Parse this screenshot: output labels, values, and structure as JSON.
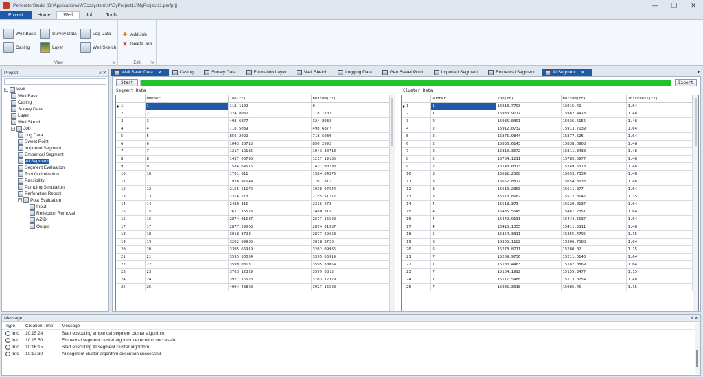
{
  "window": {
    "title": "PerforatorStudio [D:\\Application\\eWEcosystem\\sh\\ByProject11\\MyProject11.perfprj]",
    "minimize": "—",
    "maximize": "❐",
    "close": "✕"
  },
  "menu": {
    "project": "Project",
    "items": [
      "Home",
      "Well",
      "Job",
      "Tools"
    ]
  },
  "ribbon": {
    "view_group": {
      "label": "View",
      "buttons": [
        "Well Basic",
        "Survey Data",
        "Log Data",
        "Casing",
        "Layer",
        "Well Sketch"
      ]
    },
    "edit_group": {
      "label": "Edit",
      "buttons": [
        "Add Job",
        "Delete Job"
      ]
    }
  },
  "project_panel": {
    "title": "Project",
    "pin": "# ✕",
    "tree": [
      {
        "label": "Well",
        "level": 0,
        "expander": "-"
      },
      {
        "label": "Well Basic",
        "level": 1
      },
      {
        "label": "Casing",
        "level": 1
      },
      {
        "label": "Survey Data",
        "level": 1
      },
      {
        "label": "Layer",
        "level": 1
      },
      {
        "label": "Well Sketch",
        "level": 1
      },
      {
        "label": "Job",
        "level": 1,
        "expander": "-"
      },
      {
        "label": "Log Data",
        "level": 2
      },
      {
        "label": "Sweet Point",
        "level": 2
      },
      {
        "label": "Imported Segment",
        "level": 2
      },
      {
        "label": "Emperical Segment",
        "level": 2
      },
      {
        "label": "AI Segment",
        "level": 2,
        "selected": true
      },
      {
        "label": "Segment Evaluation",
        "level": 2
      },
      {
        "label": "Tool Optimization",
        "level": 2
      },
      {
        "label": "Passibility",
        "level": 2
      },
      {
        "label": "Pumping Simulation",
        "level": 2
      },
      {
        "label": "Perforation Report",
        "level": 2
      },
      {
        "label": "Post Evaluation",
        "level": 2,
        "expander": "-"
      },
      {
        "label": "Input",
        "level": 3
      },
      {
        "label": "Reflection Removal",
        "level": 3
      },
      {
        "label": "AZID",
        "level": 3
      },
      {
        "label": "Output",
        "level": 3
      }
    ]
  },
  "tabs": [
    {
      "label": "Well Basic Data",
      "active": true
    },
    {
      "label": "Casing"
    },
    {
      "label": "Survey Data"
    },
    {
      "label": "Formation Layer"
    },
    {
      "label": "Well Sketch"
    },
    {
      "label": "Logging Data"
    },
    {
      "label": "Geo Sweet Point"
    },
    {
      "label": "Imported Segment"
    },
    {
      "label": "Emperical Segment"
    },
    {
      "label": "AI Segment",
      "active": true
    }
  ],
  "toolbar": {
    "start_label": "Start",
    "export_label": "Export",
    "progress_fraction": 1.0
  },
  "segment_grid": {
    "title": "Segment Data",
    "columns": [
      "Number",
      "Top(ft)",
      "Bottom(ft)"
    ],
    "rows": [
      [
        "1",
        "118.1102",
        "0"
      ],
      [
        "2",
        "324.8032",
        "118.1102"
      ],
      [
        "3",
        "498.6877",
        "324.8032"
      ],
      [
        "4",
        "718.5039",
        "498.6877"
      ],
      [
        "5",
        "856.2992",
        "718.5039"
      ],
      [
        "6",
        "1043.30713",
        "856.2992"
      ],
      [
        "7",
        "1217.19185",
        "1043.30713"
      ],
      [
        "8",
        "1437.00793",
        "1217.19185"
      ],
      [
        "9",
        "1584.64576",
        "1437.00793"
      ],
      [
        "10",
        "1761.811",
        "1584.64576"
      ],
      [
        "11",
        "1938.97644",
        "1761.811"
      ],
      [
        "12",
        "2155.51172",
        "1938.97644"
      ],
      [
        "13",
        "2316.273",
        "2155.51172"
      ],
      [
        "14",
        "2480.315",
        "2316.273"
      ],
      [
        "15",
        "2677.16528",
        "2480.315"
      ],
      [
        "16",
        "2874.01587",
        "2677.16528"
      ],
      [
        "17",
        "2877.29663",
        "2874.01587"
      ],
      [
        "18",
        "3018.3728",
        "2877.29663"
      ],
      [
        "19",
        "3202.09985",
        "3018.3728"
      ],
      [
        "20",
        "3395.66919",
        "3202.09985"
      ],
      [
        "21",
        "3595.80054",
        "3395.66919"
      ],
      [
        "22",
        "3599.0813",
        "3595.80054"
      ],
      [
        "23",
        "3763.12329",
        "3599.0813"
      ],
      [
        "24",
        "3927.16528",
        "3763.12329"
      ],
      [
        "25",
        "4094.48828",
        "3927.16528"
      ]
    ]
  },
  "cluster_grid": {
    "title": "Cluster Data",
    "columns": [
      "Number",
      "Top(ft)",
      "Bottom(ft)",
      "Thickness(ft)"
    ],
    "rows": [
      [
        "1",
        "16013.7793",
        "16015.42",
        "1.64"
      ],
      [
        "1",
        "15980.9717",
        "15982.4473",
        "1.48"
      ],
      [
        "2",
        "15935.0391",
        "15936.5156",
        "1.48"
      ],
      [
        "2",
        "15912.0732",
        "15913.7139",
        "1.64"
      ],
      [
        "2",
        "15875.9844",
        "15877.625",
        "1.64"
      ],
      [
        "2",
        "15836.6143",
        "15838.0908",
        "1.48"
      ],
      [
        "2",
        "15810.3672",
        "15811.8438",
        "1.48"
      ],
      [
        "2",
        "15784.1211",
        "15785.5977",
        "1.48"
      ],
      [
        "2",
        "15748.0313",
        "15749.5078",
        "1.48"
      ],
      [
        "3",
        "15692.2568",
        "15693.7334",
        "1.48"
      ],
      [
        "3",
        "15652.8877",
        "15654.3633",
        "1.48"
      ],
      [
        "3",
        "15610.2363",
        "15611.877",
        "1.64"
      ],
      [
        "3",
        "15570.8662",
        "15572.0146",
        "1.15"
      ],
      [
        "4",
        "15518.373",
        "15520.0137",
        "1.64"
      ],
      [
        "4",
        "15485.5645",
        "15487.2051",
        "1.64"
      ],
      [
        "4",
        "15442.9131",
        "15444.5537",
        "1.64"
      ],
      [
        "4",
        "15410.1055",
        "15411.5811",
        "1.48"
      ],
      [
        "5",
        "15354.3311",
        "15355.4795",
        "1.15"
      ],
      [
        "6",
        "15305.1182",
        "15306.7588",
        "1.64"
      ],
      [
        "6",
        "15278.8711",
        "15280.02",
        "1.15"
      ],
      [
        "7",
        "15209.9736",
        "15211.6143",
        "1.64"
      ],
      [
        "7",
        "15180.4463",
        "15182.0869",
        "1.64"
      ],
      [
        "7",
        "15154.1992",
        "15155.3477",
        "1.15"
      ],
      [
        "7",
        "15111.5488",
        "15113.0254",
        "1.48"
      ],
      [
        "7",
        "15085.3018",
        "15086.45",
        "1.15"
      ]
    ]
  },
  "message_panel": {
    "title": "Message",
    "pin": "# ✕",
    "columns": [
      "Type",
      "Creation Time",
      "Message"
    ],
    "rows": [
      [
        "Info",
        "10:15:24",
        "Start executing emperical segment cluster algorithm."
      ],
      [
        "Info",
        "10:15:50",
        "Emperical segment cluster algorithm execution successful."
      ],
      [
        "Info",
        "10:16:15",
        "Start executing AI segment cluster algorithm."
      ],
      [
        "Info",
        "10:17:30",
        "AI segment cluster algorithm execution successful."
      ]
    ]
  }
}
